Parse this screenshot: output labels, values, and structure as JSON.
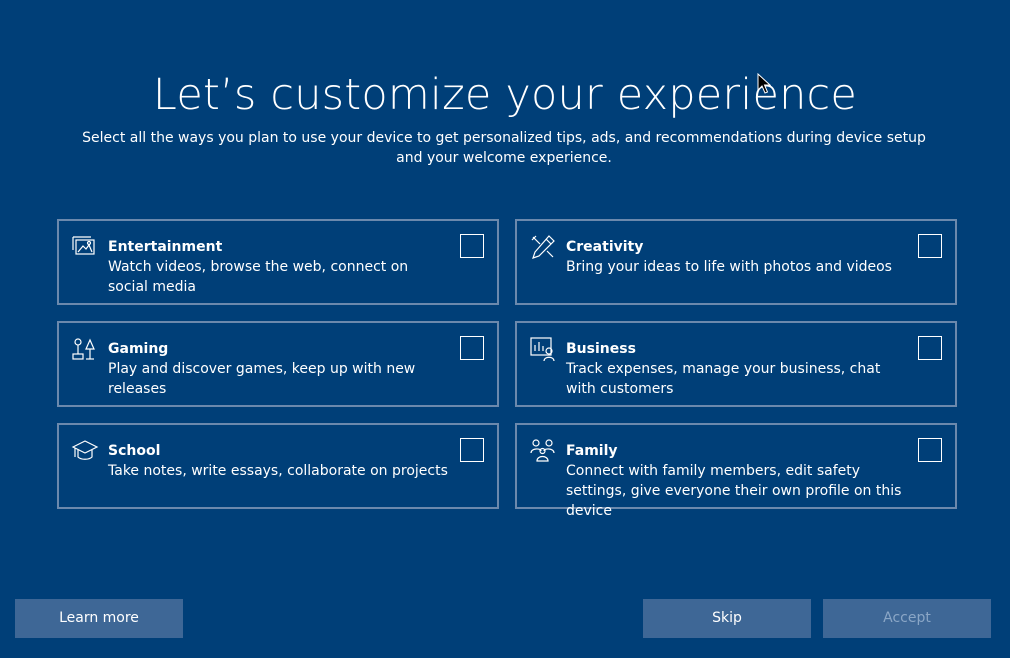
{
  "page": {
    "title": "Let’s customize your experience",
    "subtitle": "Select all the ways you plan to use your device to get personalized tips, ads, and recommendations during device setup and your welcome experience."
  },
  "cards": [
    {
      "name": "Entertainment",
      "description": "Watch videos, browse the web, connect on social media",
      "icon": "entertainment-icon",
      "checked": false
    },
    {
      "name": "Creativity",
      "description": "Bring your ideas to life with photos and videos",
      "icon": "creativity-icon",
      "checked": false
    },
    {
      "name": "Gaming",
      "description": "Play and discover games, keep up with new releases",
      "icon": "gaming-icon",
      "checked": false
    },
    {
      "name": "Business",
      "description": "Track expenses, manage your business, chat with customers",
      "icon": "business-icon",
      "checked": false
    },
    {
      "name": "School",
      "description": "Take notes, write essays, collaborate on projects",
      "icon": "school-icon",
      "checked": false
    },
    {
      "name": "Family",
      "description": "Connect with family members, edit safety settings, give everyone their own profile on this device",
      "icon": "family-icon",
      "checked": false
    }
  ],
  "buttons": {
    "learn_more": "Learn more",
    "skip": "Skip",
    "accept": "Accept"
  },
  "colors": {
    "background": "#003f78",
    "card_border": "#6b89ad",
    "button_bg": "#3e6796",
    "disabled_text": "#8aa6c6"
  }
}
